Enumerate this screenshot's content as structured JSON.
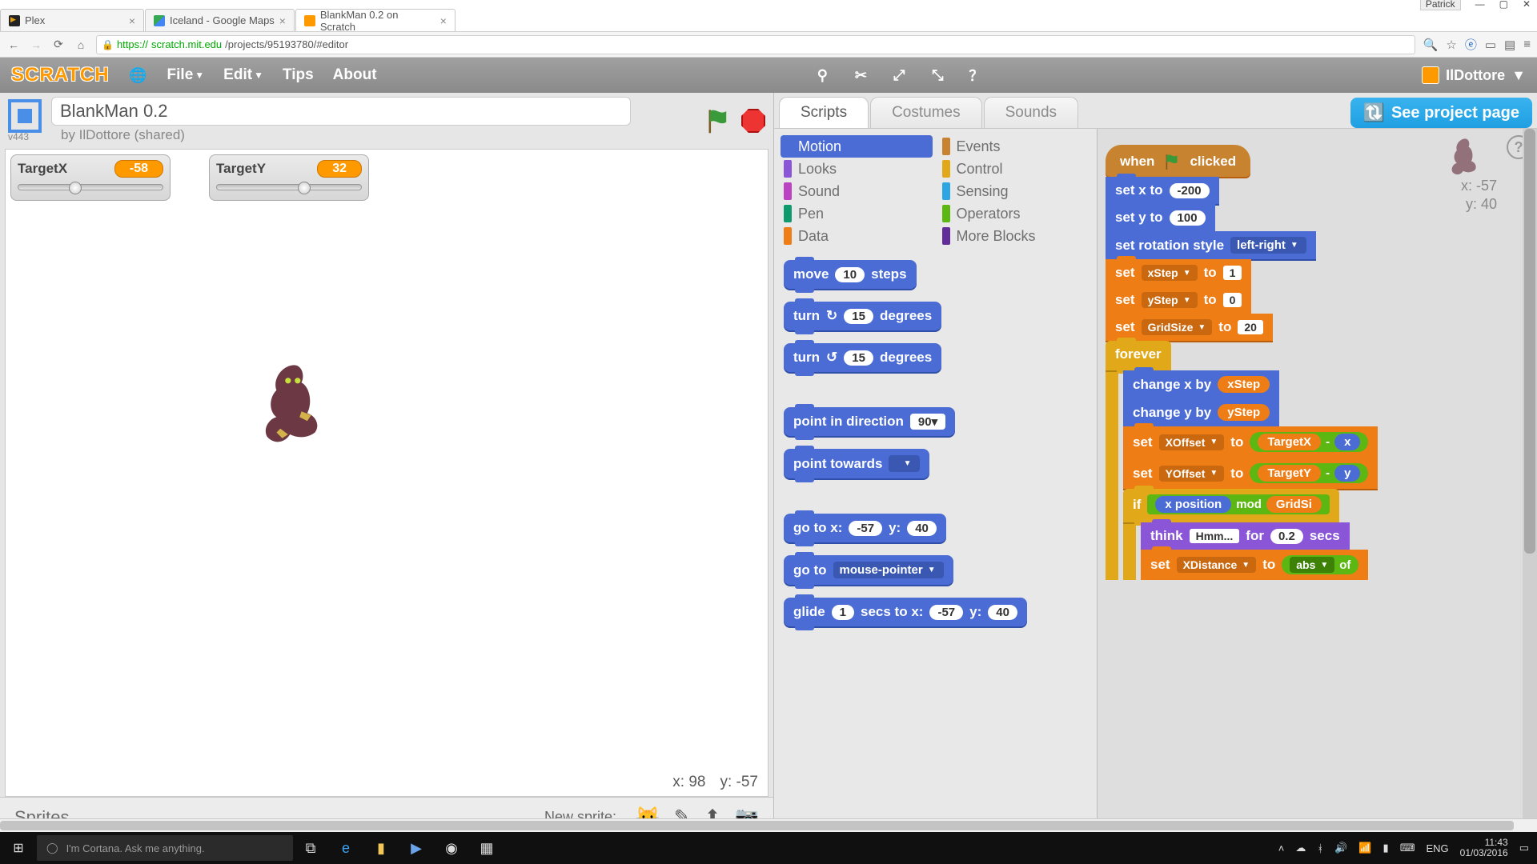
{
  "os": {
    "user": "Patrick",
    "cortana_placeholder": "I'm Cortana. Ask me anything.",
    "lang": "ENG",
    "time": "11:43",
    "date": "01/03/2016"
  },
  "browser": {
    "tabs": [
      {
        "title": "Plex",
        "favicon": "plex"
      },
      {
        "title": "Iceland - Google Maps",
        "favicon": "gmap"
      },
      {
        "title": "BlankMan 0.2 on Scratch",
        "favicon": "scratch",
        "active": true
      }
    ],
    "url_https": "https://",
    "url_host": "scratch.mit.edu",
    "url_path": "/projects/95193780/#editor"
  },
  "scratch": {
    "logo": "SCRATCH",
    "menus": {
      "file": "File",
      "edit": "Edit",
      "tips": "Tips",
      "about": "About"
    },
    "username": "IlDottore",
    "see_project": "See project page",
    "version": "v443"
  },
  "project": {
    "title": "BlankMan 0.2",
    "byline": "by IlDottore (shared)"
  },
  "stage": {
    "monitors": [
      {
        "name": "TargetX",
        "value": "-58",
        "thumb_pct": 35
      },
      {
        "name": "TargetY",
        "value": "32",
        "thumb_pct": 56
      }
    ],
    "cursor": {
      "x": "98",
      "y": "-57"
    }
  },
  "sprites": {
    "heading": "Sprites",
    "new_label": "New sprite:"
  },
  "tabs": {
    "scripts": "Scripts",
    "costumes": "Costumes",
    "sounds": "Sounds"
  },
  "categories": [
    {
      "name": "Motion",
      "color": "#4a6cd4",
      "active": true
    },
    {
      "name": "Events",
      "color": "#c88330"
    },
    {
      "name": "Looks",
      "color": "#8a55d7"
    },
    {
      "name": "Control",
      "color": "#e1a91a"
    },
    {
      "name": "Sound",
      "color": "#bb42c3"
    },
    {
      "name": "Sensing",
      "color": "#2ca5e2"
    },
    {
      "name": "Pen",
      "color": "#0e9a6c"
    },
    {
      "name": "Operators",
      "color": "#5cb712"
    },
    {
      "name": "Data",
      "color": "#ee7d16"
    },
    {
      "name": "More Blocks",
      "color": "#632d99"
    }
  ],
  "palette": {
    "move": "move",
    "steps": "steps",
    "move_val": "10",
    "turn": "turn",
    "degrees": "degrees",
    "turn_cw": "15",
    "turn_ccw": "15",
    "point_dir": "point in direction",
    "point_dir_val": "90",
    "point_towards": "point towards",
    "goto_xy": "go to x:",
    "goto_y": "y:",
    "goto_x_val": "-57",
    "goto_y_val": "40",
    "goto": "go to",
    "goto_target": "mouse-pointer",
    "glide": "glide",
    "secs_to_x": "secs to x:",
    "glide_s": "1",
    "glide_x": "-57",
    "glide_y": "40"
  },
  "canvas": {
    "sprite_coords": {
      "x": "-57",
      "y": "40"
    },
    "script": {
      "hat": "when",
      "hat2": "clicked",
      "setx": "set x to",
      "setx_v": "-200",
      "sety": "set y to",
      "sety_v": "100",
      "rot": "set rotation style",
      "rot_v": "left-right",
      "set": "set",
      "to": "to",
      "xstep": "xStep",
      "xstep_v": "1",
      "ystep": "yStep",
      "ystep_v": "0",
      "gridsize": "GridSize",
      "gridsize_v": "20",
      "forever": "forever",
      "chx": "change x by",
      "chy": "change y by",
      "xoffset": "XOffset",
      "yoffset": "YOffset",
      "targetx": "TargetX",
      "targety": "TargetY",
      "if": "if",
      "xpos": "x position",
      "mod": "mod",
      "gridsi": "GridSi",
      "think": "think",
      "think_v": "Hmm...",
      "for": "for",
      "think_s": "0.2",
      "secs": "secs",
      "xdist": "XDistance",
      "abs": "abs",
      "of": "of"
    }
  }
}
